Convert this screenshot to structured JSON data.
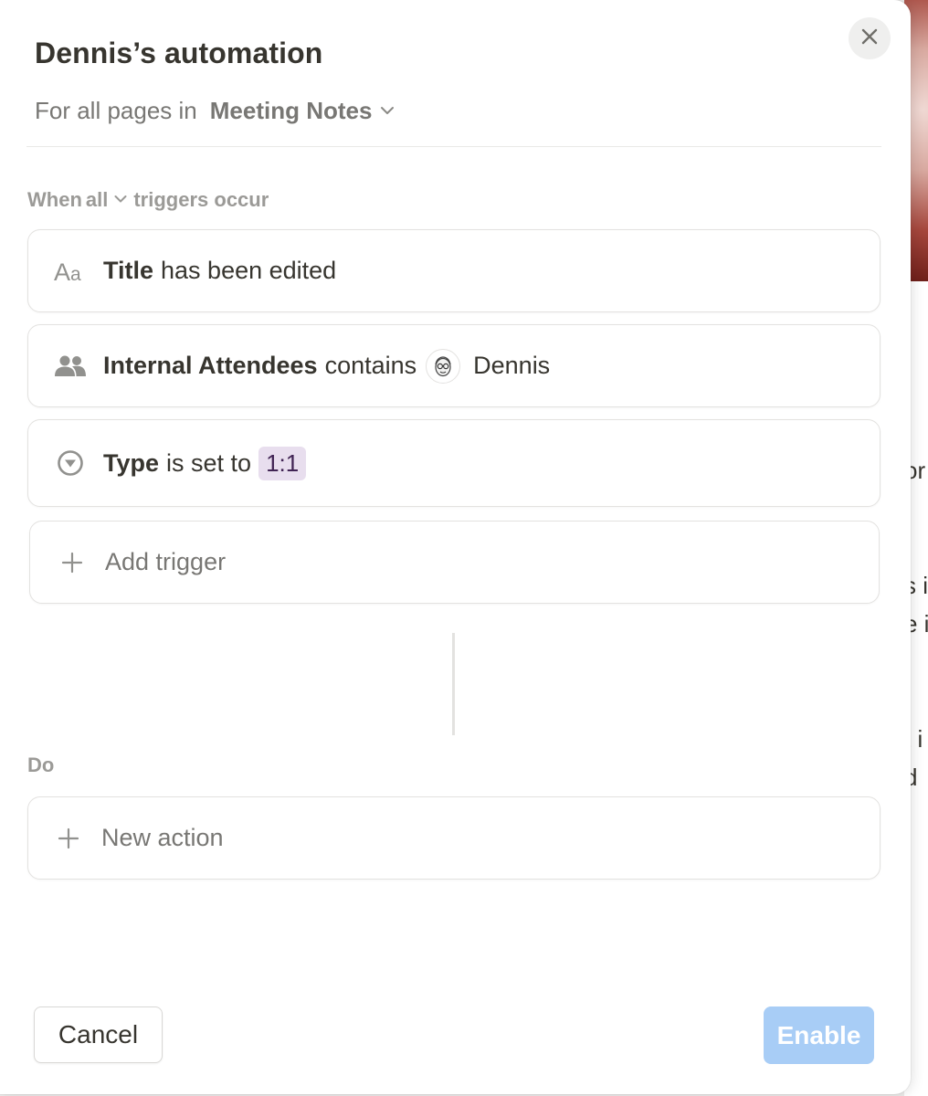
{
  "background": {
    "fragments": [
      "or",
      "s i",
      "e i",
      "t i",
      "d"
    ]
  },
  "modal": {
    "title": "Dennis’s automation",
    "scope_prefix": "For all pages in",
    "database": "Meeting Notes"
  },
  "triggers": {
    "label_when": "When",
    "mode": "all",
    "label_suffix": "triggers occur",
    "items": [
      {
        "icon": "text-property-icon",
        "property": "Title",
        "condition": "has been edited"
      },
      {
        "icon": "people-icon",
        "property": "Internal Attendees",
        "condition": "contains",
        "value": "Dennis"
      },
      {
        "icon": "select-property-icon",
        "property": "Type",
        "condition": "is set to",
        "value": "1:1"
      }
    ],
    "add_label": "Add trigger"
  },
  "actions": {
    "label": "Do",
    "new_label": "New action"
  },
  "footer": {
    "cancel": "Cancel",
    "enable": "Enable"
  },
  "colors": {
    "tag_bg": "#e8deee",
    "tag_text": "#412454",
    "enable_bg": "#a8cdf6"
  }
}
